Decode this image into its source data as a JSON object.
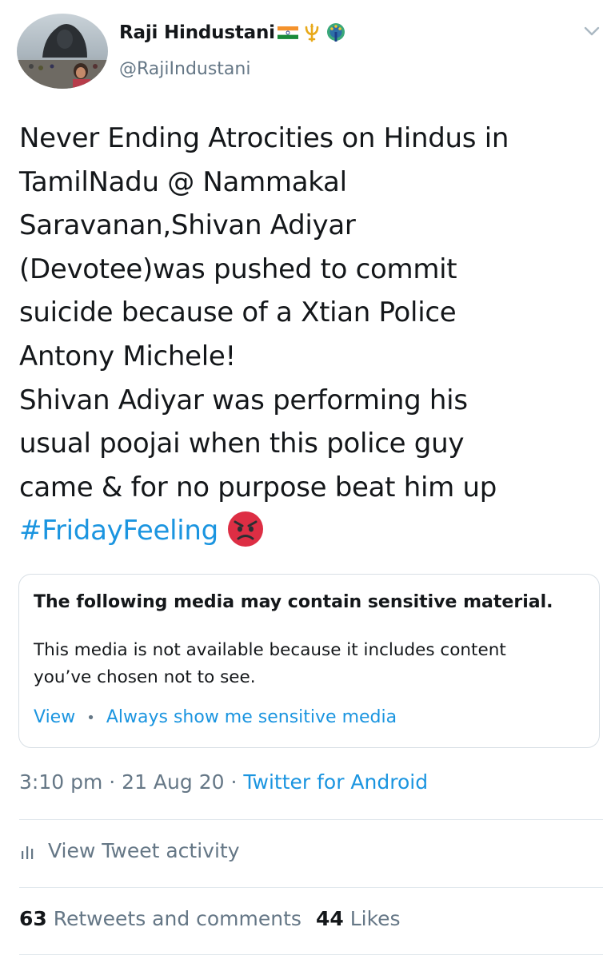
{
  "user": {
    "display_name": "Raji Hindustani",
    "display_name_emoji": [
      "india-flag-icon",
      "trident-icon",
      "peacock-icon"
    ],
    "handle": "@RajiIndustani"
  },
  "tweet": {
    "lines": [
      "Never Ending Atrocities on Hindus in",
      "TamilNadu @ Nammakal",
      "Saravanan,Shivan Adiyar",
      "(Devotee)was pushed to commit",
      "suicide because of a Xtian Police",
      "Antony Michele!",
      "Shivan Adiyar was performing his",
      "usual poojai when this police guy",
      "came & for no purpose beat him up"
    ],
    "hashtag": "#FridayFeeling",
    "trailing_emoji": "angry-face-icon"
  },
  "sensitive_media": {
    "title": "The following media may contain sensitive material.",
    "body_lines": [
      "This media is not available because it includes content",
      "you’ve chosen not to see."
    ],
    "view_label": "View",
    "separator": "•",
    "always_show_label": "Always show me sensitive media"
  },
  "meta": {
    "time": "3:10 pm",
    "sep1": "·",
    "date": "21 Aug 20",
    "sep2": "·",
    "source": "Twitter for Android"
  },
  "activity": {
    "label": "View Tweet activity",
    "icon": "bar-chart-icon"
  },
  "stats": {
    "retweets_count": "63",
    "retweets_label": "Retweets and comments",
    "likes_count": "44",
    "likes_label": "Likes"
  },
  "colors": {
    "link": "#1b95e0",
    "secondary": "#657786",
    "primary": "#14171a",
    "divider": "#e1e8ed"
  }
}
